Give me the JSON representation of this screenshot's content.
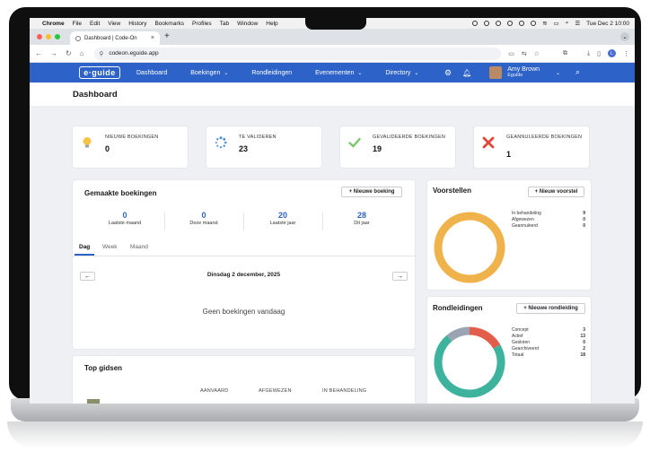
{
  "menubar": {
    "app": "Chrome",
    "items": [
      "File",
      "Edit",
      "View",
      "History",
      "Bookmarks",
      "Profiles",
      "Tab",
      "Window",
      "Help"
    ],
    "clock": "Tue Dec 2  10:00"
  },
  "browser": {
    "tab_title": "Dashboard | Code-On",
    "url": "codeon.eguide.app",
    "profile_initial": "L"
  },
  "nav": {
    "logo": "e·guide",
    "items": [
      {
        "label": "Dashboard",
        "dropdown": false
      },
      {
        "label": "Boekingen",
        "dropdown": true
      },
      {
        "label": "Rondleidingen",
        "dropdown": false
      },
      {
        "label": "Evenementen",
        "dropdown": true
      },
      {
        "label": "Directory",
        "dropdown": true
      }
    ],
    "user_name": "Amy Brown",
    "user_org": "Eguide"
  },
  "page": {
    "title": "Dashboard"
  },
  "stats": [
    {
      "label": "NIEUWE BOEKINGEN",
      "value": "0",
      "icon": "lightbulb-icon"
    },
    {
      "label": "TE VALIDEREN",
      "value": "23",
      "icon": "spinner-icon"
    },
    {
      "label": "GEVALIDEERDE BOEKINGEN",
      "value": "19",
      "icon": "check-icon"
    },
    {
      "label": "GEANNULEERDE BOEKINGEN",
      "value": "1",
      "icon": "cross-icon"
    }
  ],
  "bookings": {
    "title": "Gemaakte boekingen",
    "new_button": "+ Nieuwe boeking",
    "metrics": [
      {
        "value": "0",
        "label": "Laatste maand"
      },
      {
        "value": "0",
        "label": "Deze maand"
      },
      {
        "value": "20",
        "label": "Laatste jaar"
      },
      {
        "value": "28",
        "label": "Dit jaar"
      }
    ],
    "tabs": [
      "Dag",
      "Week",
      "Maand"
    ],
    "date": "Dinsdag 2 december, 2025",
    "prev": "←",
    "next": "→",
    "empty": "Geen boekingen vandaag"
  },
  "proposals": {
    "title": "Voorstellen",
    "new_button": "+ Nieuw voorstel",
    "legend": [
      {
        "label": "In behandeling",
        "value": "9"
      },
      {
        "label": "Afgewezen",
        "value": "0"
      },
      {
        "label": "Geannuleerd",
        "value": "0"
      }
    ]
  },
  "tours": {
    "title": "Rondleidingen",
    "new_button": "+ Nieuwe rondleiding",
    "legend": [
      {
        "label": "Concept",
        "value": "3"
      },
      {
        "label": "Actief",
        "value": "13"
      },
      {
        "label": "Gesloten",
        "value": "0"
      },
      {
        "label": "Gearchiveerd",
        "value": "2"
      },
      {
        "label": "Totaal",
        "value": "18"
      }
    ]
  },
  "top_guides": {
    "title": "Top gidsen",
    "columns": [
      "AANVAARD",
      "AFGEWEZEN",
      "IN BEHANDELING"
    ]
  },
  "chart_data": [
    {
      "type": "pie",
      "title": "Voorstellen",
      "categories": [
        "In behandeling",
        "Afgewezen",
        "Geannuleerd"
      ],
      "values": [
        9,
        0,
        0
      ],
      "colors": [
        "#f0b24a",
        "#e25d4a",
        "#3db39e"
      ]
    },
    {
      "type": "pie",
      "title": "Rondleidingen",
      "categories": [
        "Concept",
        "Actief",
        "Gesloten",
        "Gearchiveerd"
      ],
      "values": [
        3,
        13,
        0,
        2
      ],
      "colors": [
        "#e25d4a",
        "#3db39e",
        "#f0b24a",
        "#9aa4b2"
      ]
    }
  ],
  "colors": {
    "brand": "#2d63c8",
    "page_bg": "#eef0f4"
  }
}
